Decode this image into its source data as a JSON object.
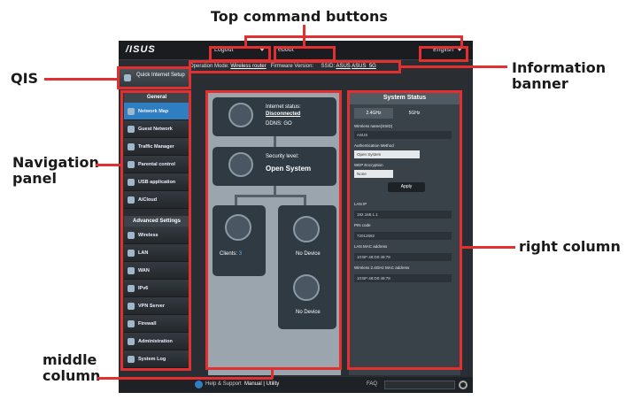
{
  "annotations": {
    "top_command_buttons": "Top command buttons",
    "qis": "QIS",
    "information_banner": "Information\nbanner",
    "navigation_panel": "Navigation\npanel",
    "right_column": "right column",
    "middle_column": "middle\ncolumn"
  },
  "router": {
    "logo": "/ISUS",
    "logout": "Logout",
    "reboot": "eboot",
    "language": "English",
    "info": {
      "mode_label": "Operation Mode:",
      "mode_value": "Wireless router",
      "fw_label": "Firmware Version:",
      "ssid_label": "SSID:",
      "ssid_1": "ASUS",
      "ssid_2": "ASUS_5G"
    },
    "qis_label": "Quick Internet Setup",
    "general_header": "General",
    "general_items": [
      "Network Map",
      "Guest Network",
      "Traffic Manager",
      "Parental control",
      "USB application",
      "AiCloud"
    ],
    "advanced_header": "Advanced Settings",
    "advanced_items": [
      "Wireless",
      "LAN",
      "WAN",
      "IPv6",
      "VPN Server",
      "Firewall",
      "Administration",
      "System Log"
    ],
    "map": {
      "internet_status_label": "Internet status:",
      "internet_status_value": "Disconnected",
      "ddns": "DDNS: GO",
      "security_label": "Security level:",
      "security_value": "Open System",
      "clients_label": "Clients:",
      "clients_value": "3",
      "usb1": "No Device",
      "usb2": "No Device"
    },
    "status": {
      "header": "System Status",
      "tab_24": "2.4GHz",
      "tab_5": "5GHz",
      "ssid_label": "Wireless name(SSID)",
      "ssid_value": "ASUS",
      "auth_label": "Authentication Method",
      "auth_value": "Open System",
      "wep_label": "WEP Encryption",
      "wep_value": "None",
      "apply": "Apply",
      "lanip_label": "LAN IP",
      "lanip_value": "192.168.1.1",
      "pin_label": "PIN code",
      "pin_value": "72012692",
      "lanmac_label": "LAN MAC address",
      "lanmac_value": "10:BF:48:D0:49:78",
      "wmac_label": "Wireless 2.4GHz MAC address",
      "wmac_value": "10:BF:48:D0:49:78"
    },
    "footer": {
      "help": "Help & Support",
      "manual": "Manual | Utility",
      "faq": "FAQ"
    }
  }
}
